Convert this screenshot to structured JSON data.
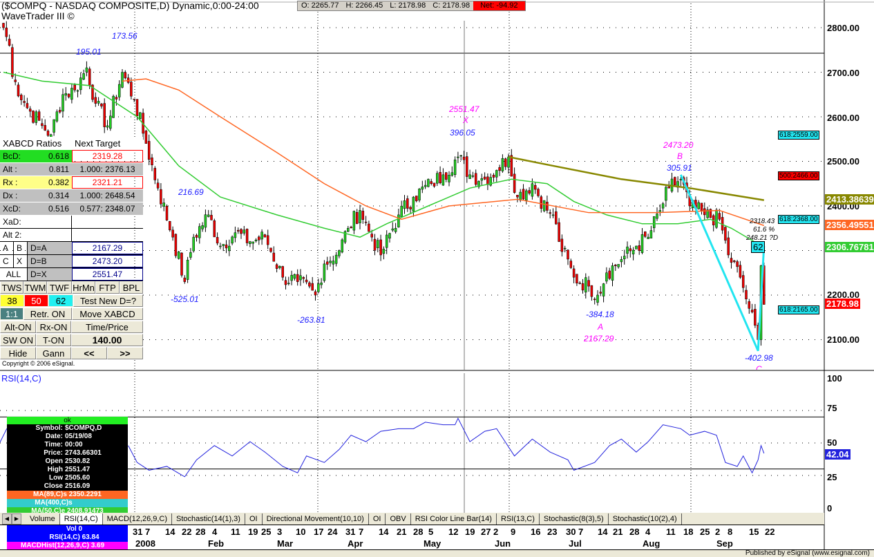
{
  "header": {
    "title": "($COMPQ - NASDAQ COMPOSITE,D) Dynamic,0:00-24:00",
    "subtitle": "WaveTrader III ©",
    "open": "O: 2265.77",
    "high": "H: 2266.45",
    "low": "L: 2178.98",
    "close": "C: 2178.98",
    "net": "Net: -94.92"
  },
  "annotations": {
    "a1": "195.01",
    "a2": "173.56",
    "a3": "216.69",
    "a4": "-525.01",
    "a5": "-263.81",
    "x_price": "2551.47",
    "x_label": "X",
    "x_blue": "396.05",
    "b_price": "2473.20",
    "b_label": "B",
    "b_blue": "305.91",
    "d1": "2318.43",
    "d2": "61.6 %",
    "d3": "248.21 ?D",
    "a_blue": "-384.18",
    "a_label": "A",
    "a_price": "2167.29",
    "c_blue": "-402.98",
    "c_label": "C",
    "box62": "62"
  },
  "price_axis": [
    "2800.00",
    "2700.00",
    "2600.00",
    "2500.00",
    "2400.00",
    "2200.00",
    "2100.00"
  ],
  "badges": {
    "ma400": "2413.38639",
    "ma89": "2356.49551",
    "ma50": "2306.76781",
    "last": "2178.98"
  },
  "tags": {
    "t1": "618:2559.00",
    "t2": "500:2466.00",
    "t3": "618:2368.00",
    "t4": "618:2165.00"
  },
  "panel": {
    "header": "XABCD Ratios",
    "header2": "Next Target",
    "rows": [
      {
        "k": "BcD:",
        "v": "0.618",
        "t": "2319.28"
      },
      {
        "k": "Alt  :",
        "v": "0.811",
        "t": "1.000: 2376.13"
      },
      {
        "k": "Rx  :",
        "v": "0.382",
        "t": "2321.21"
      },
      {
        "k": "Dx  :",
        "v": "0.314",
        "t": "1.000: 2648.54"
      },
      {
        "k": "XcD:",
        "v": "0.516",
        "t": "0.577: 2348.07"
      }
    ],
    "xad": "XaD:",
    "alt2": "Alt 2:",
    "a": "A",
    "b": "B",
    "c": "C",
    "x": "X",
    "all": "ALL",
    "da": "D=A",
    "db": "D=B",
    "dx": "D=X",
    "vda": "2167.29",
    "vdb": "2473.20",
    "vdx": "2551.47",
    "tws": "TWS",
    "twm": "TWM",
    "twf": "TWF",
    "hrmn": "HrMn",
    "ftp": "FTP",
    "bpl": "BPL",
    "n38": "38",
    "n50": "50",
    "n62": "62",
    "test": "Test New D=?",
    "one": "1:1",
    "retr": "Retr. ON",
    "move": "Move XABCD",
    "alton": "Alt-ON",
    "rxon": "Rx-ON",
    "timeprice": "Time/Price",
    "swon": "SW ON",
    "ton": "T-ON",
    "value": "140.00",
    "hide": "Hide",
    "gann": "Gann",
    "prev": "<<",
    "next": ">>",
    "copyright": "Copyright © 2006 eSignal."
  },
  "rsi": {
    "label": "RSI(14,C)",
    "axis": [
      "100",
      "75",
      "50",
      "25",
      "0"
    ],
    "badge": "42.04"
  },
  "data_window": {
    "status": "ok",
    "rows": [
      [
        "Symbol:",
        "$COMPQ,D"
      ],
      [
        "Date:",
        "05/19/08"
      ],
      [
        "Time:",
        "00:00"
      ],
      [
        "Price:",
        "2743.66301"
      ],
      [
        "Open",
        "2530.82"
      ],
      [
        "High",
        "2551.47"
      ],
      [
        "Low",
        "2505.60"
      ],
      [
        "Close",
        "2516.09"
      ]
    ],
    "ma89": "MA(89,C)s 2350.2291",
    "ma400": "MA(400,C)s",
    "ma50": "MA(50,C)e 2408.91473",
    "vol": "Vol 0",
    "rsi": "RSI(14,C) 63.84",
    "macd": "MACDHist(12,26,9,C) 3.69"
  },
  "tabs": [
    "Volume",
    "RSI(14,C)",
    "MACD(12,26,9,C)",
    "Stochastic(14(1),3)",
    "OI",
    "Directional Movement(10,10)",
    "OI",
    "OBV",
    "RSI Color Line Bar(14)",
    "RSI(13,C)",
    "Stochastic(8(3),5)",
    "Stochastic(10(2),4)"
  ],
  "dates": [
    "31",
    "7",
    "14",
    "22",
    "28",
    "4",
    "11",
    "19",
    "25",
    "3",
    "10",
    "17",
    "24",
    "31",
    "7",
    "14",
    "21",
    "28",
    "5",
    "12",
    "19",
    "27",
    "2",
    "9",
    "16",
    "23",
    "30",
    "7",
    "14",
    "21",
    "28",
    "4",
    "11",
    "18",
    "25",
    "2",
    "8",
    "15",
    "22"
  ],
  "months": [
    "2008",
    "Feb",
    "Mar",
    "Apr",
    "May",
    "Jun",
    "Jul",
    "Aug",
    "Sep"
  ],
  "status": "Published by eSignal (www.esignal.com)",
  "colors": {
    "up": "#22cc22",
    "down": "#ee0000",
    "ma50": "#33cc33",
    "ma89": "#ff6622",
    "ma400": "#888800",
    "pattern": "#22e5f0",
    "rsi": "#2222dd"
  },
  "chart_data": {
    "type": "candlestick",
    "symbol": "$COMPQ",
    "price_range": [
      2040,
      2850
    ],
    "close_anchors": [
      [
        0,
        2800
      ],
      [
        2,
        2760
      ],
      [
        3,
        2690
      ],
      [
        8,
        2620
      ],
      [
        13,
        2580
      ],
      [
        16,
        2560
      ],
      [
        20,
        2650
      ],
      [
        24,
        2660
      ],
      [
        28,
        2710
      ],
      [
        31,
        2630
      ],
      [
        35,
        2580
      ],
      [
        40,
        2700
      ],
      [
        44,
        2640
      ],
      [
        48,
        2540
      ],
      [
        52,
        2440
      ],
      [
        57,
        2330
      ],
      [
        61,
        2230
      ],
      [
        64,
        2330
      ],
      [
        69,
        2380
      ],
      [
        73,
        2310
      ],
      [
        78,
        2340
      ],
      [
        83,
        2320
      ],
      [
        88,
        2330
      ],
      [
        94,
        2240
      ],
      [
        99,
        2230
      ],
      [
        105,
        2200
      ],
      [
        108,
        2270
      ],
      [
        113,
        2300
      ],
      [
        116,
        2350
      ],
      [
        120,
        2390
      ],
      [
        124,
        2330
      ],
      [
        127,
        2290
      ],
      [
        133,
        2380
      ],
      [
        138,
        2420
      ],
      [
        144,
        2450
      ],
      [
        148,
        2470
      ],
      [
        153,
        2510
      ],
      [
        157,
        2470
      ],
      [
        162,
        2460
      ],
      [
        166,
        2480
      ],
      [
        170,
        2510
      ],
      [
        173,
        2420
      ],
      [
        178,
        2450
      ],
      [
        183,
        2390
      ],
      [
        185,
        2380
      ],
      [
        187,
        2320
      ],
      [
        192,
        2240
      ],
      [
        197,
        2220
      ],
      [
        200,
        2200
      ],
      [
        203,
        2250
      ],
      [
        208,
        2280
      ],
      [
        213,
        2310
      ],
      [
        217,
        2330
      ],
      [
        221,
        2390
      ],
      [
        224,
        2440
      ],
      [
        228,
        2460
      ],
      [
        231,
        2400
      ],
      [
        236,
        2380
      ],
      [
        241,
        2370
      ],
      [
        244,
        2290
      ],
      [
        248,
        2240
      ],
      [
        251,
        2170
      ],
      [
        254,
        2100
      ],
      [
        255,
        2266
      ],
      [
        256,
        2179
      ]
    ],
    "ma50": [
      [
        0,
        2700
      ],
      [
        13,
        2680
      ],
      [
        29,
        2670
      ],
      [
        45,
        2600
      ],
      [
        59,
        2490
      ],
      [
        73,
        2420
      ],
      [
        92,
        2380
      ],
      [
        108,
        2350
      ],
      [
        120,
        2330
      ],
      [
        129,
        2360
      ],
      [
        143,
        2400
      ],
      [
        157,
        2440
      ],
      [
        171,
        2460
      ],
      [
        183,
        2450
      ],
      [
        192,
        2410
      ],
      [
        203,
        2380
      ],
      [
        215,
        2360
      ],
      [
        227,
        2360
      ],
      [
        238,
        2370
      ],
      [
        245,
        2350
      ],
      [
        256,
        2307
      ]
    ],
    "ma89": [
      [
        40,
        2680
      ],
      [
        48,
        2685
      ],
      [
        59,
        2660
      ],
      [
        73,
        2600
      ],
      [
        92,
        2520
      ],
      [
        108,
        2450
      ],
      [
        122,
        2400
      ],
      [
        134,
        2370
      ],
      [
        150,
        2400
      ],
      [
        173,
        2415
      ],
      [
        197,
        2385
      ],
      [
        220,
        2385
      ],
      [
        241,
        2390
      ],
      [
        256,
        2356
      ]
    ],
    "ma400": [
      [
        170,
        2510
      ],
      [
        185,
        2490
      ],
      [
        208,
        2460
      ],
      [
        231,
        2440
      ],
      [
        256,
        2413
      ]
    ],
    "pattern": [
      [
        228,
        2470
      ],
      [
        254,
        2075
      ],
      [
        256,
        2310
      ]
    ],
    "rsi": [
      [
        42,
        48
      ],
      [
        45,
        35
      ],
      [
        49,
        29
      ],
      [
        55,
        32
      ],
      [
        61,
        24
      ],
      [
        65,
        37
      ],
      [
        71,
        48
      ],
      [
        77,
        40
      ],
      [
        83,
        51
      ],
      [
        88,
        43
      ],
      [
        94,
        32
      ],
      [
        99,
        27
      ],
      [
        102,
        40
      ],
      [
        108,
        35
      ],
      [
        113,
        45
      ],
      [
        117,
        56
      ],
      [
        122,
        51
      ],
      [
        127,
        59
      ],
      [
        133,
        61
      ],
      [
        138,
        61
      ],
      [
        142,
        66
      ],
      [
        148,
        64
      ],
      [
        152,
        64
      ],
      [
        153,
        69
      ],
      [
        157,
        51
      ],
      [
        162,
        59
      ],
      [
        166,
        61
      ],
      [
        172,
        40
      ],
      [
        178,
        53
      ],
      [
        184,
        43
      ],
      [
        190,
        37
      ],
      [
        192,
        29
      ],
      [
        199,
        35
      ],
      [
        204,
        48
      ],
      [
        208,
        53
      ],
      [
        213,
        43
      ],
      [
        217,
        51
      ],
      [
        222,
        64
      ],
      [
        228,
        61
      ],
      [
        231,
        56
      ],
      [
        236,
        59
      ],
      [
        240,
        56
      ],
      [
        243,
        35
      ],
      [
        247,
        32
      ],
      [
        249,
        40
      ],
      [
        252,
        27
      ],
      [
        254,
        37
      ],
      [
        255,
        48
      ],
      [
        256,
        42
      ]
    ],
    "rsi_levels": [
      70,
      30
    ]
  }
}
